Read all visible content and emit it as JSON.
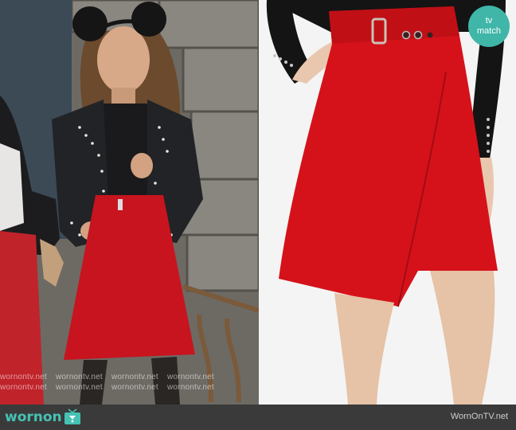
{
  "left_photo": {
    "watermark_text": "wornontv.net",
    "watermark_color": "#ffffff"
  },
  "right_photo": {
    "badge": {
      "line1": "tv",
      "line2": "match",
      "color": "#3fb6a8"
    },
    "skirt_color": "#d5121a"
  },
  "footer": {
    "logo": {
      "word1": "worn",
      "word2": "on",
      "icon": "tv-icon",
      "color": "#46c2b4"
    },
    "site": "WornOnTV.net",
    "background": "#3a3a3a"
  }
}
